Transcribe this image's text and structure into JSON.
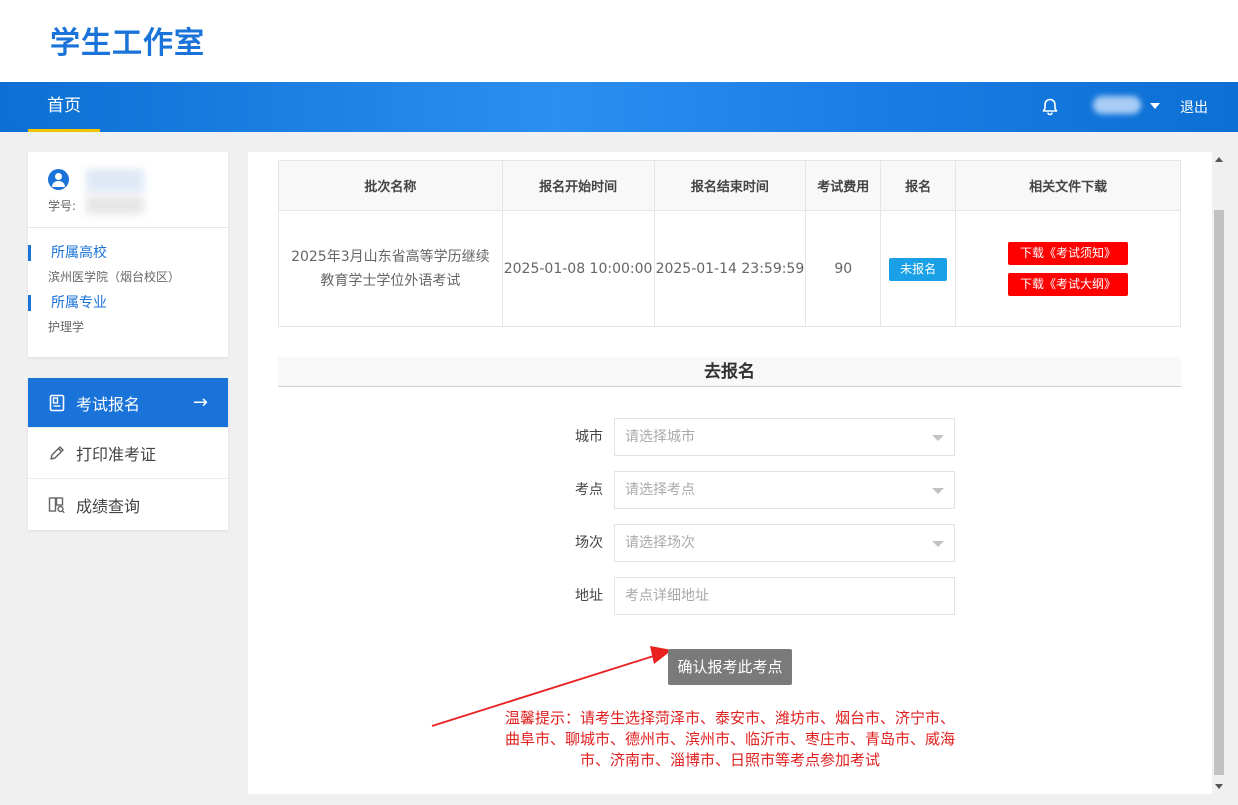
{
  "brand": "学生工作室",
  "nav": {
    "home": "首页",
    "logout": "退出"
  },
  "profile": {
    "student_id_label": "学号:",
    "school_label": "所属高校",
    "school_value": "滨州医学院（烟台校区）",
    "major_label": "所属专业",
    "major_value": "护理学"
  },
  "menu": [
    {
      "label": "考试报名",
      "icon": "document-icon",
      "active": true
    },
    {
      "label": "打印准考证",
      "icon": "pencil-icon",
      "active": false
    },
    {
      "label": "成绩查询",
      "icon": "search-doc-icon",
      "active": false
    }
  ],
  "table": {
    "headers": [
      "批次名称",
      "报名开始时间",
      "报名结束时间",
      "考试费用",
      "报名",
      "相关文件下载"
    ],
    "row": {
      "batch_name": "2025年3月山东省高等学历继续教育学士学位外语考试",
      "start_time": "2025-01-08 10:00:00",
      "end_time": "2025-01-14 23:59:59",
      "fee": "90",
      "status": "未报名",
      "download_1": "下载《考试须知》",
      "download_2": "下载《考试大纲》"
    }
  },
  "register": {
    "title": "去报名",
    "city_label": "城市",
    "city_placeholder": "请选择城市",
    "site_label": "考点",
    "site_placeholder": "请选择考点",
    "session_label": "场次",
    "session_placeholder": "请选择场次",
    "address_label": "地址",
    "address_placeholder": "考点详细地址",
    "confirm": "确认报考此考点",
    "tip": "温馨提示：请考生选择菏泽市、泰安市、潍坊市、烟台市、济宁市、曲阜市、聊城市、德州市、滨州市、临沂市、枣庄市、青岛市、威海市、济南市、淄博市、日照市等考点参加考试"
  },
  "colors": {
    "primary": "#1a73d9",
    "nav_accent": "#f5c400",
    "danger": "#ff0000",
    "status": "#1aa0e6"
  }
}
